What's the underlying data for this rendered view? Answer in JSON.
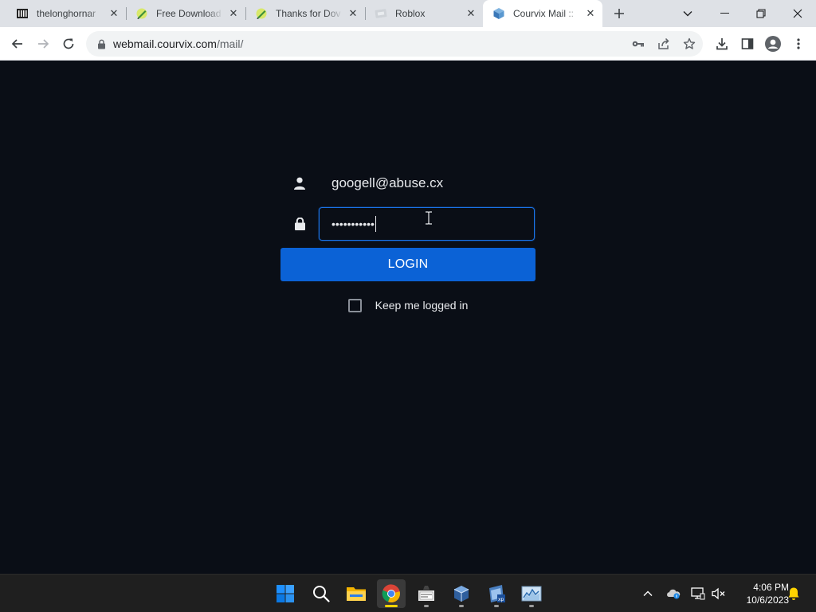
{
  "browser": {
    "tabs": [
      {
        "title": "thelonghornar",
        "favicon": "book-icon",
        "active": false
      },
      {
        "title": "Free Download",
        "favicon": "pencil-icon",
        "active": false
      },
      {
        "title": "Thanks for Dov",
        "favicon": "pencil-icon",
        "active": false
      },
      {
        "title": "Roblox",
        "favicon": "roblox-icon",
        "active": false
      },
      {
        "title": "Courvix Mail :: ",
        "favicon": "cube-icon",
        "active": true
      }
    ],
    "url_host": "webmail.courvix.com",
    "url_path": "/mail/"
  },
  "login": {
    "username": "googell@abuse.cx",
    "password_mask": "•••••••••••",
    "button_label": "LOGIN",
    "keep_logged_in_label": "Keep me logged in",
    "keep_logged_in_checked": false,
    "button_color": "#0b62d6",
    "focus_color": "#1a73e8"
  },
  "taskbar": {
    "apps": [
      "windows-start-icon",
      "search-icon",
      "file-explorer-icon",
      "chrome-icon",
      "app-icon",
      "virtualbox-icon",
      "winxp-app-icon",
      "task-manager-icon"
    ],
    "time": "4:06 PM",
    "date": "10/6/2023"
  }
}
